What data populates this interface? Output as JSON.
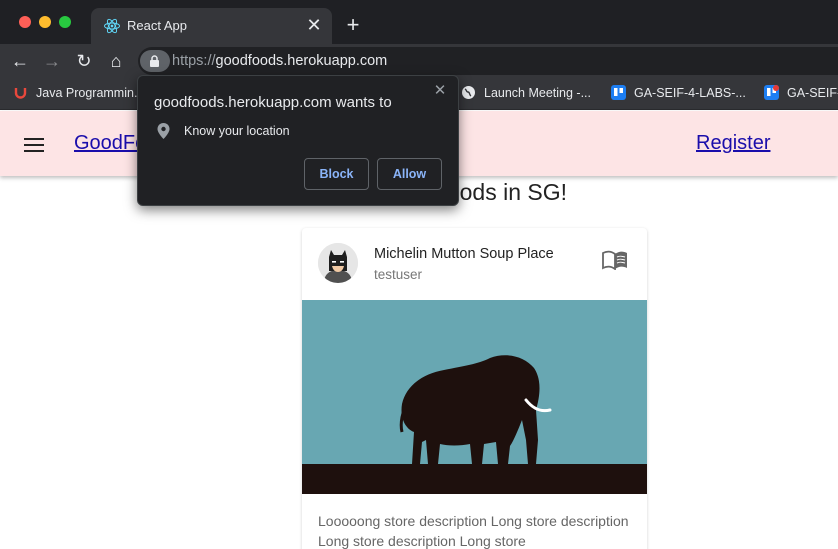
{
  "browser": {
    "tab": {
      "title": "React App",
      "close": "✕"
    },
    "new_tab": "+",
    "url": {
      "scheme": "https://",
      "host": "goodfoods.herokuapp.com"
    },
    "nav": {
      "back": "←",
      "forward": "→",
      "reload": "↻",
      "home": "⌂"
    },
    "bookmarks": [
      {
        "label": "Java Programmin..."
      },
      {
        "label": "Launch Meeting -..."
      },
      {
        "label": "GA-SEIF-4-LABS-..."
      },
      {
        "label": "GA-SEIF-"
      }
    ]
  },
  "permission_popup": {
    "title": "goodfoods.herokuapp.com wants to",
    "permission": "Know your location",
    "block_label": "Block",
    "allow_label": "Allow",
    "close": "✕"
  },
  "app": {
    "brand": "GoodFo",
    "register_label": "Register",
    "welcome": "dFoods in SG!",
    "card": {
      "title": "Michelin Mutton Soup Place",
      "subtitle": "testuser",
      "description": "Looooong store description Long store description Long store description Long store"
    }
  },
  "colors": {
    "appbar": "#fde4e5",
    "link": "#1a0dab",
    "media_sky": "#68a7b2",
    "media_ground": "#1e100d",
    "popup_bg": "#202124",
    "button_text": "#8ab4f8"
  }
}
